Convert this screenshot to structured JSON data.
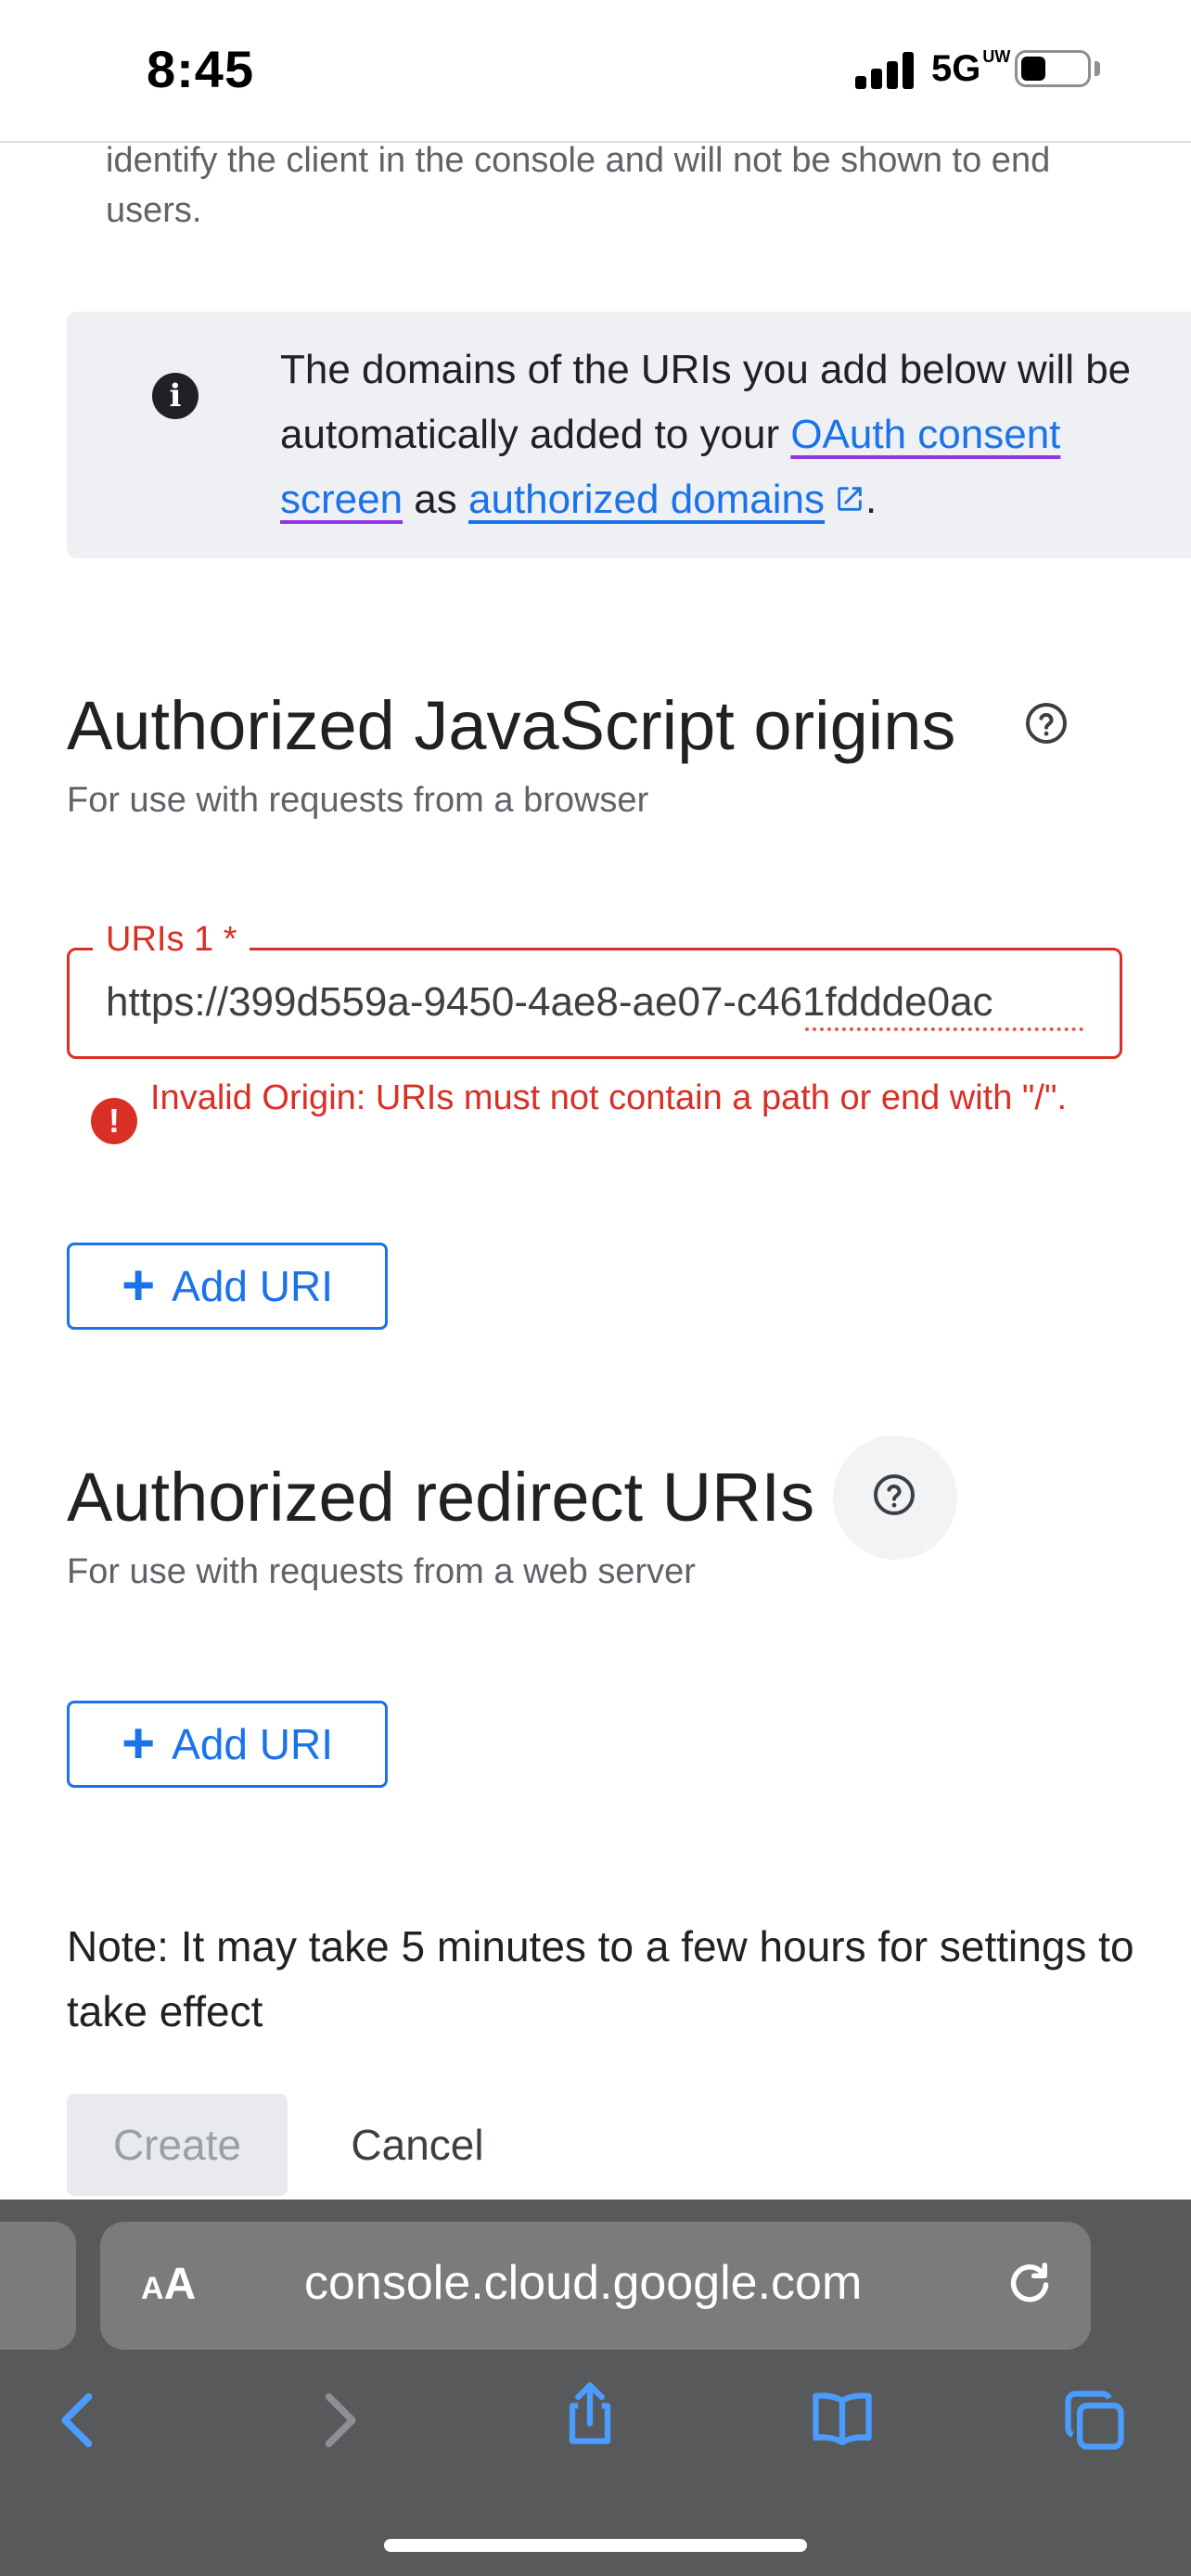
{
  "status_bar": {
    "time": "8:45",
    "network": "5G",
    "network_suffix": "UW"
  },
  "top_description": "identify the client in the console and will not be shown to end users.",
  "info_box": {
    "icon": "info-icon",
    "line1": "The domains of the URIs you add below will be",
    "line2_prefix": "automatically added to your ",
    "link_consent_part1": "OAuth consent",
    "link_consent_part2": "screen",
    "as_text": " as ",
    "link_domains": "authorized domains",
    "period": "."
  },
  "js_origins": {
    "title": "Authorized JavaScript origins",
    "subtitle": "For use with requests from a browser",
    "field_label": "URIs 1 *",
    "field_value": "https://399d559a-9450-4ae8-ae07-c461fddde0ac",
    "error": "Invalid Origin: URIs must not contain a path or end with \"/\".",
    "add_button": "Add URI"
  },
  "redirect_uris": {
    "title": "Authorized redirect URIs",
    "subtitle": "For use with requests from a web server",
    "add_button": "Add URI"
  },
  "note": "Note: It may take 5 minutes to a few hours for settings to take effect",
  "actions": {
    "create": "Create",
    "cancel": "Cancel"
  },
  "browser": {
    "aa_label_small": "A",
    "aa_label_large": "A",
    "url": "console.cloud.google.com"
  },
  "colors": {
    "link": "#1a73e8",
    "error": "#d93025",
    "info_bg": "#eef0f4",
    "toolbar_bg": "#58595b"
  }
}
